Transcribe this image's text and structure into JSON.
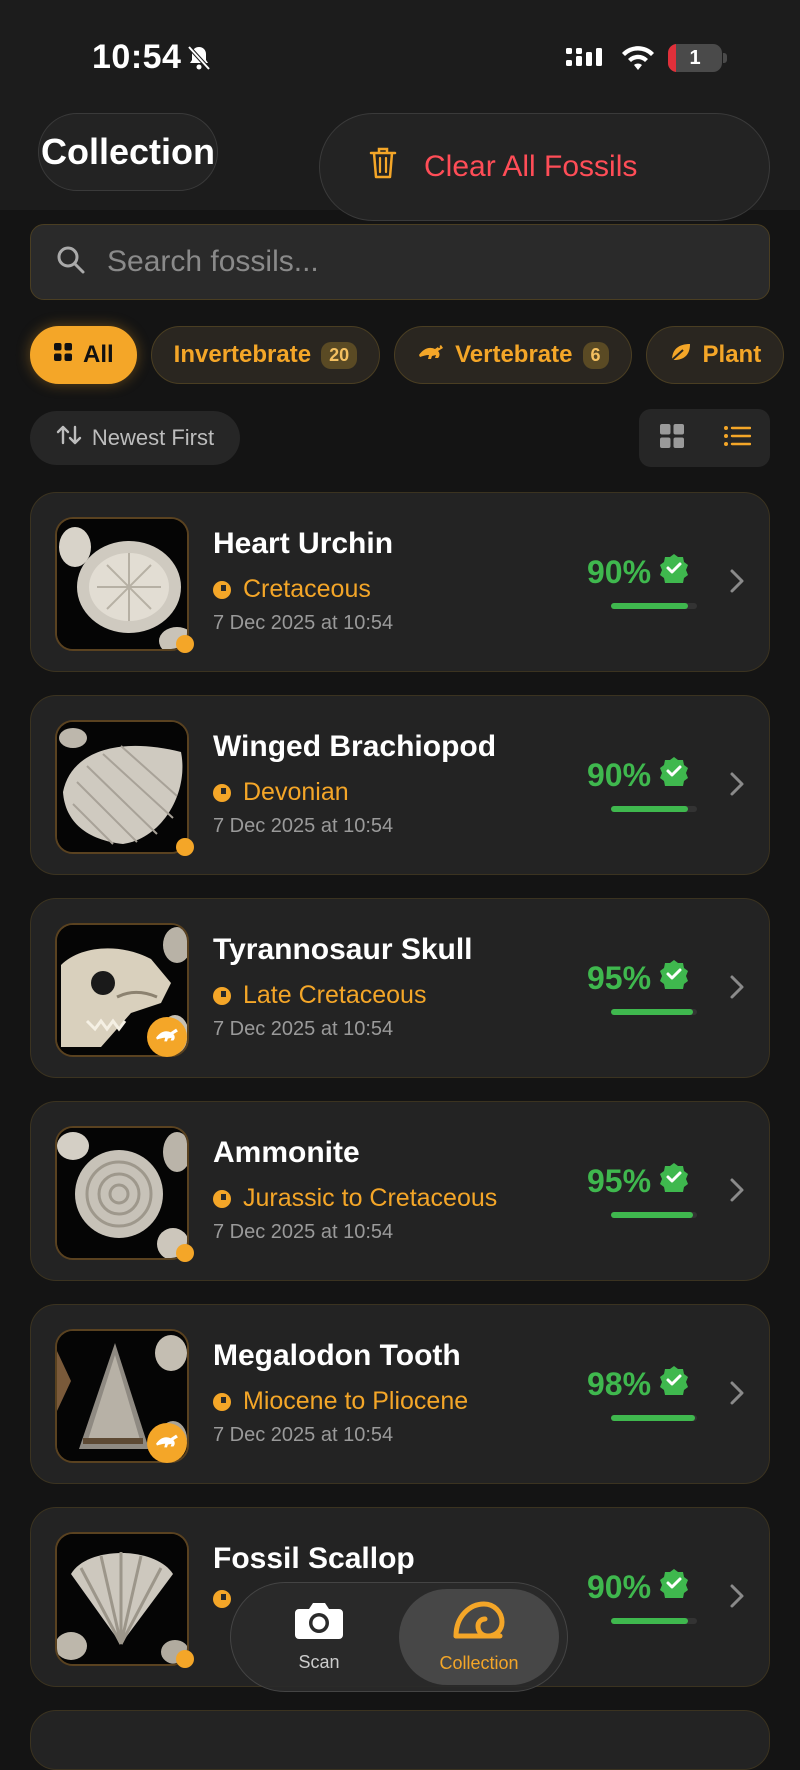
{
  "status_bar": {
    "time": "10:54",
    "battery": "1"
  },
  "header": {
    "title": "Collection",
    "clear_label": "Clear All Fossils"
  },
  "search": {
    "placeholder": "Search fossils..."
  },
  "filters": [
    {
      "label": "All",
      "count": null,
      "active": true
    },
    {
      "label": "Invertebrate",
      "count": "20",
      "active": false
    },
    {
      "label": "Vertebrate",
      "count": "6",
      "active": false
    },
    {
      "label": "Plant",
      "count": null,
      "active": false
    }
  ],
  "sort": {
    "label": "Newest First"
  },
  "view": {
    "selected": "list"
  },
  "fossils": [
    {
      "name": "Heart Urchin",
      "period": "Cretaceous",
      "date": "7 Dec 2025 at 10:54",
      "confidence": "90%",
      "confidence_value": 0.9,
      "category": "invertebrate"
    },
    {
      "name": "Winged Brachiopod",
      "period": "Devonian",
      "date": "7 Dec 2025 at 10:54",
      "confidence": "90%",
      "confidence_value": 0.9,
      "category": "invertebrate"
    },
    {
      "name": "Tyrannosaur Skull",
      "period": "Late Cretaceous",
      "date": "7 Dec 2025 at 10:54",
      "confidence": "95%",
      "confidence_value": 0.95,
      "category": "vertebrate"
    },
    {
      "name": "Ammonite",
      "period": "Jurassic to Cretaceous",
      "date": "7 Dec 2025 at 10:54",
      "confidence": "95%",
      "confidence_value": 0.95,
      "category": "invertebrate"
    },
    {
      "name": "Megalodon Tooth",
      "period": "Miocene to Pliocene",
      "date": "7 Dec 2025 at 10:54",
      "confidence": "98%",
      "confidence_value": 0.98,
      "category": "vertebrate"
    },
    {
      "name": "Fossil Scallop",
      "period": "",
      "date": "",
      "confidence": "90%",
      "confidence_value": 0.9,
      "category": "invertebrate"
    }
  ],
  "tab_bar": [
    {
      "label": "Scan",
      "icon": "camera-icon",
      "active": false
    },
    {
      "label": "Collection",
      "icon": "ammonite-icon",
      "active": true
    }
  ],
  "colors": {
    "accent": "#f4a628",
    "confidence": "#3fb84e",
    "danger": "#ff4d57",
    "background": "#141414"
  }
}
